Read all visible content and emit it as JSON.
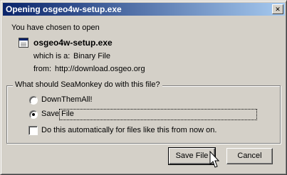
{
  "window": {
    "title": "Opening osgeo4w-setup.exe",
    "close_glyph": "✕"
  },
  "intro": "You have chosen to open",
  "file": {
    "name": "osgeo4w-setup.exe",
    "icon": "file-icon",
    "which_label": "which is a:",
    "which_value": "Binary File",
    "from_label": "from:",
    "from_value": "http://download.osgeo.org"
  },
  "group": {
    "label": "What should SeaMonkey do with this file?",
    "options": [
      {
        "label": "DownThemAll!",
        "selected": false
      },
      {
        "label": "Save File",
        "selected": true
      }
    ],
    "auto_checkbox": {
      "label": "Do this automatically for files like this from now on.",
      "checked": false
    }
  },
  "buttons": {
    "save": "Save File",
    "cancel": "Cancel"
  }
}
